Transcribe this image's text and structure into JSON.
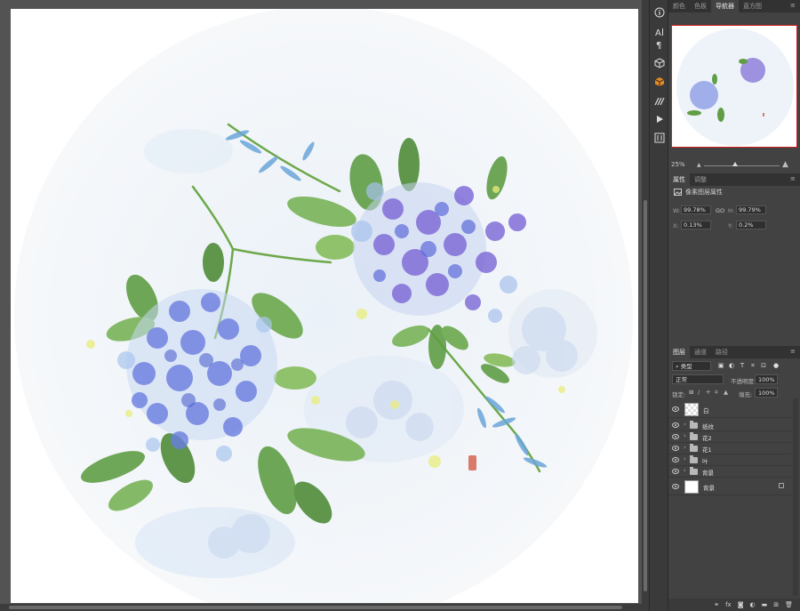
{
  "canvas": {
    "flower_colors": {
      "blue": "#6a7de0",
      "violet": "#7a66d6",
      "light_blue": "#a9c4ec",
      "green": "#5a9a3e",
      "pale_green": "#86bd5b",
      "wash": "#e3edf7"
    }
  },
  "toolstrip": {
    "icons": [
      "info-icon",
      "character-icon",
      "paragraph-icon",
      "3d-cube-icon",
      "3d-orange-icon",
      "brush-icon",
      "play-icon",
      "tool-preset-icon"
    ]
  },
  "navigator": {
    "tabs": [
      "颜色",
      "色板",
      "导航器",
      "直方图"
    ],
    "active_tab": "导航器",
    "zoom": "25%"
  },
  "properties": {
    "tabs": [
      "属性",
      "调整"
    ],
    "title": "像素图层属性",
    "w_label": "W:",
    "w_value": "99.78%",
    "link_label": "GO",
    "h_label": "H:",
    "h_value": "99.79%",
    "x_label": "X:",
    "x_value": "0.13%",
    "y_label": "Y:",
    "y_value": "0.2%"
  },
  "layers": {
    "tabs": [
      "图层",
      "通道",
      "路径"
    ],
    "filter_kind": "类型",
    "blend_mode": "正常",
    "opacity_label": "不透明度:",
    "opacity_value": "100%",
    "lock_label": "锁定:",
    "fill_label": "填充:",
    "fill_value": "100%",
    "items": [
      {
        "name": "白",
        "type": "pixel",
        "selected": true
      },
      {
        "name": "纸纹",
        "type": "group"
      },
      {
        "name": "花2",
        "type": "group"
      },
      {
        "name": "花1",
        "type": "group"
      },
      {
        "name": "叶",
        "type": "group"
      },
      {
        "name": "背景",
        "type": "group"
      },
      {
        "name": "背景",
        "type": "background",
        "locked": true
      }
    ]
  }
}
